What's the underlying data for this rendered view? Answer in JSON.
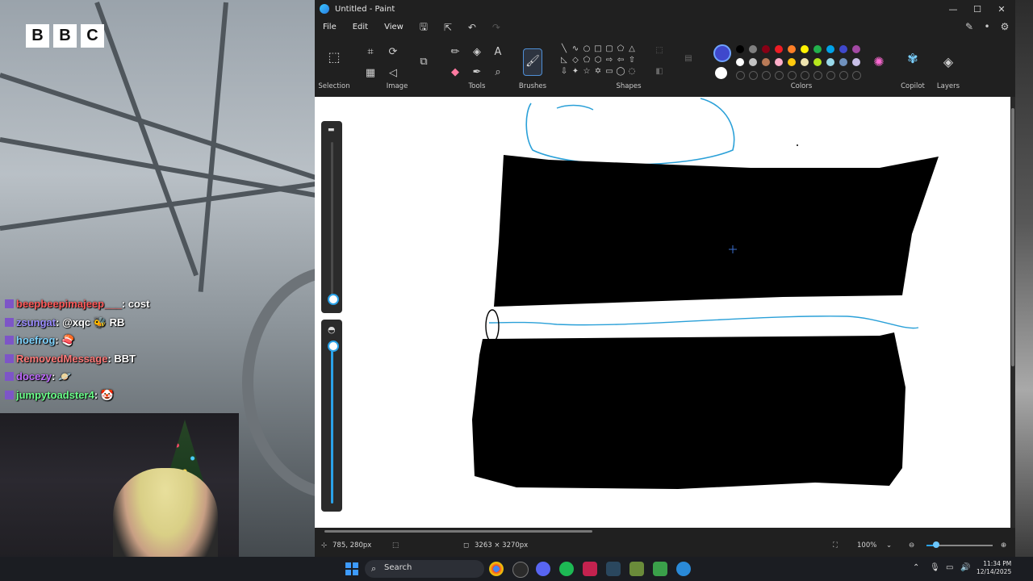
{
  "stream": {
    "logo": [
      "B",
      "B",
      "C"
    ],
    "chat": [
      {
        "user": "beepbeepimajeep___",
        "msg": "cost",
        "color": "#ff5a5a"
      },
      {
        "user": "zsungat",
        "msg": "@xqc 🐝 RB",
        "color": "#9b8cff"
      },
      {
        "user": "hoefrog",
        "msg": "🍣",
        "color": "#7fd4ff"
      },
      {
        "user": "RemovedMessage",
        "msg": "BBT",
        "color": "#ff7a7a"
      },
      {
        "user": "docezy",
        "msg": "🪐",
        "color": "#c06bff"
      },
      {
        "user": "jumpytoadster4",
        "msg": "🤡",
        "color": "#6bff8a"
      }
    ]
  },
  "paint": {
    "title": "Untitled - Paint",
    "menu": [
      "File",
      "Edit",
      "View"
    ],
    "groups": {
      "selection": "Selection",
      "image": "Image",
      "tools": "Tools",
      "brushes": "Brushes",
      "shapes": "Shapes",
      "colors": "Colors",
      "copilot": "Copilot",
      "layers": "Layers"
    },
    "palette_row1": [
      "#000000",
      "#7f7f7f",
      "#880015",
      "#ed1c24",
      "#ff7f27",
      "#fff200",
      "#22b14c",
      "#00a2e8",
      "#3f48cc",
      "#a349a4"
    ],
    "palette_row2": [
      "#ffffff",
      "#c3c3c3",
      "#b97a57",
      "#ffaec9",
      "#ffc90e",
      "#efe4b0",
      "#b5e61d",
      "#99d9ea",
      "#7092be",
      "#c8bfe7"
    ],
    "primary_color": "#3f48cc",
    "secondary_color": "#ffffff",
    "status": {
      "cursor_pos": "785, 280px",
      "canvas_size": "3263 × 3270px",
      "zoom": "100%",
      "zoom_fraction": 0.15
    }
  },
  "taskbar": {
    "search_placeholder": "Search",
    "time": "11:34 PM",
    "date": "12/14/2025"
  }
}
